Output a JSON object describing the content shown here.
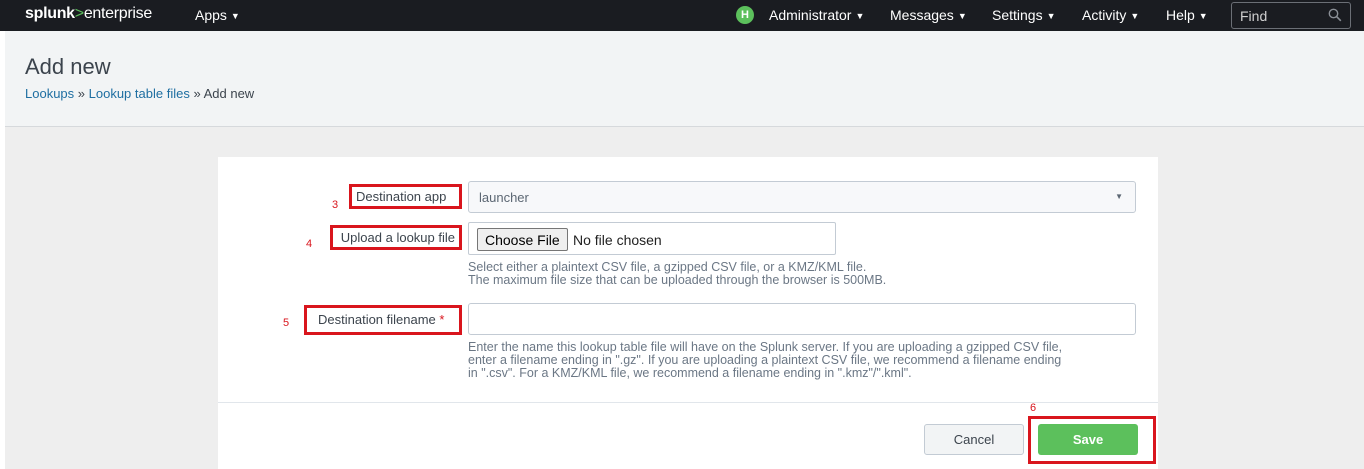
{
  "topbar": {
    "logo_brand": "splunk",
    "logo_arrow": ">",
    "logo_product": "enterprise",
    "apps_label": "Apps",
    "avatar_initial": "H",
    "user_label": "Administrator",
    "messages_label": "Messages",
    "settings_label": "Settings",
    "activity_label": "Activity",
    "help_label": "Help",
    "find_placeholder": "Find",
    "search_icon": "search-icon",
    "caret_icon": "chevron-down-icon",
    "avatar_color": "#5cc05c"
  },
  "header": {
    "title": "Add new",
    "breadcrumb": [
      {
        "label": "Lookups"
      },
      {
        "label": "Lookup table files"
      },
      {
        "label": "Add new"
      }
    ],
    "separator": "»"
  },
  "form": {
    "destination_app": {
      "label": "Destination app",
      "annotation": "3",
      "value": "launcher"
    },
    "upload": {
      "label": "Upload a lookup file",
      "annotation": "4",
      "button_label": "Choose File",
      "status": "No file chosen",
      "help_line1": "Select either a plaintext CSV file, a gzipped CSV file, or a KMZ/KML file.",
      "help_line2": "The maximum file size that can be uploaded through the browser is 500MB."
    },
    "destination_filename": {
      "label": "Destination filename",
      "required_mark": "*",
      "annotation": "5",
      "value": "",
      "help_line1": "Enter the name this lookup table file will have on the Splunk server. If you are uploading a gzipped CSV file,",
      "help_line2": "enter a filename ending in \".gz\". If you are uploading a plaintext CSV file, we recommend a filename ending",
      "help_line3": "in \".csv\". For a KMZ/KML file, we recommend a filename ending in \".kmz\"/\".kml\"."
    }
  },
  "actions": {
    "cancel_label": "Cancel",
    "save_label": "Save",
    "save_annotation": "6",
    "save_color": "#5cc05c",
    "annotation_color": "#d9151d"
  }
}
